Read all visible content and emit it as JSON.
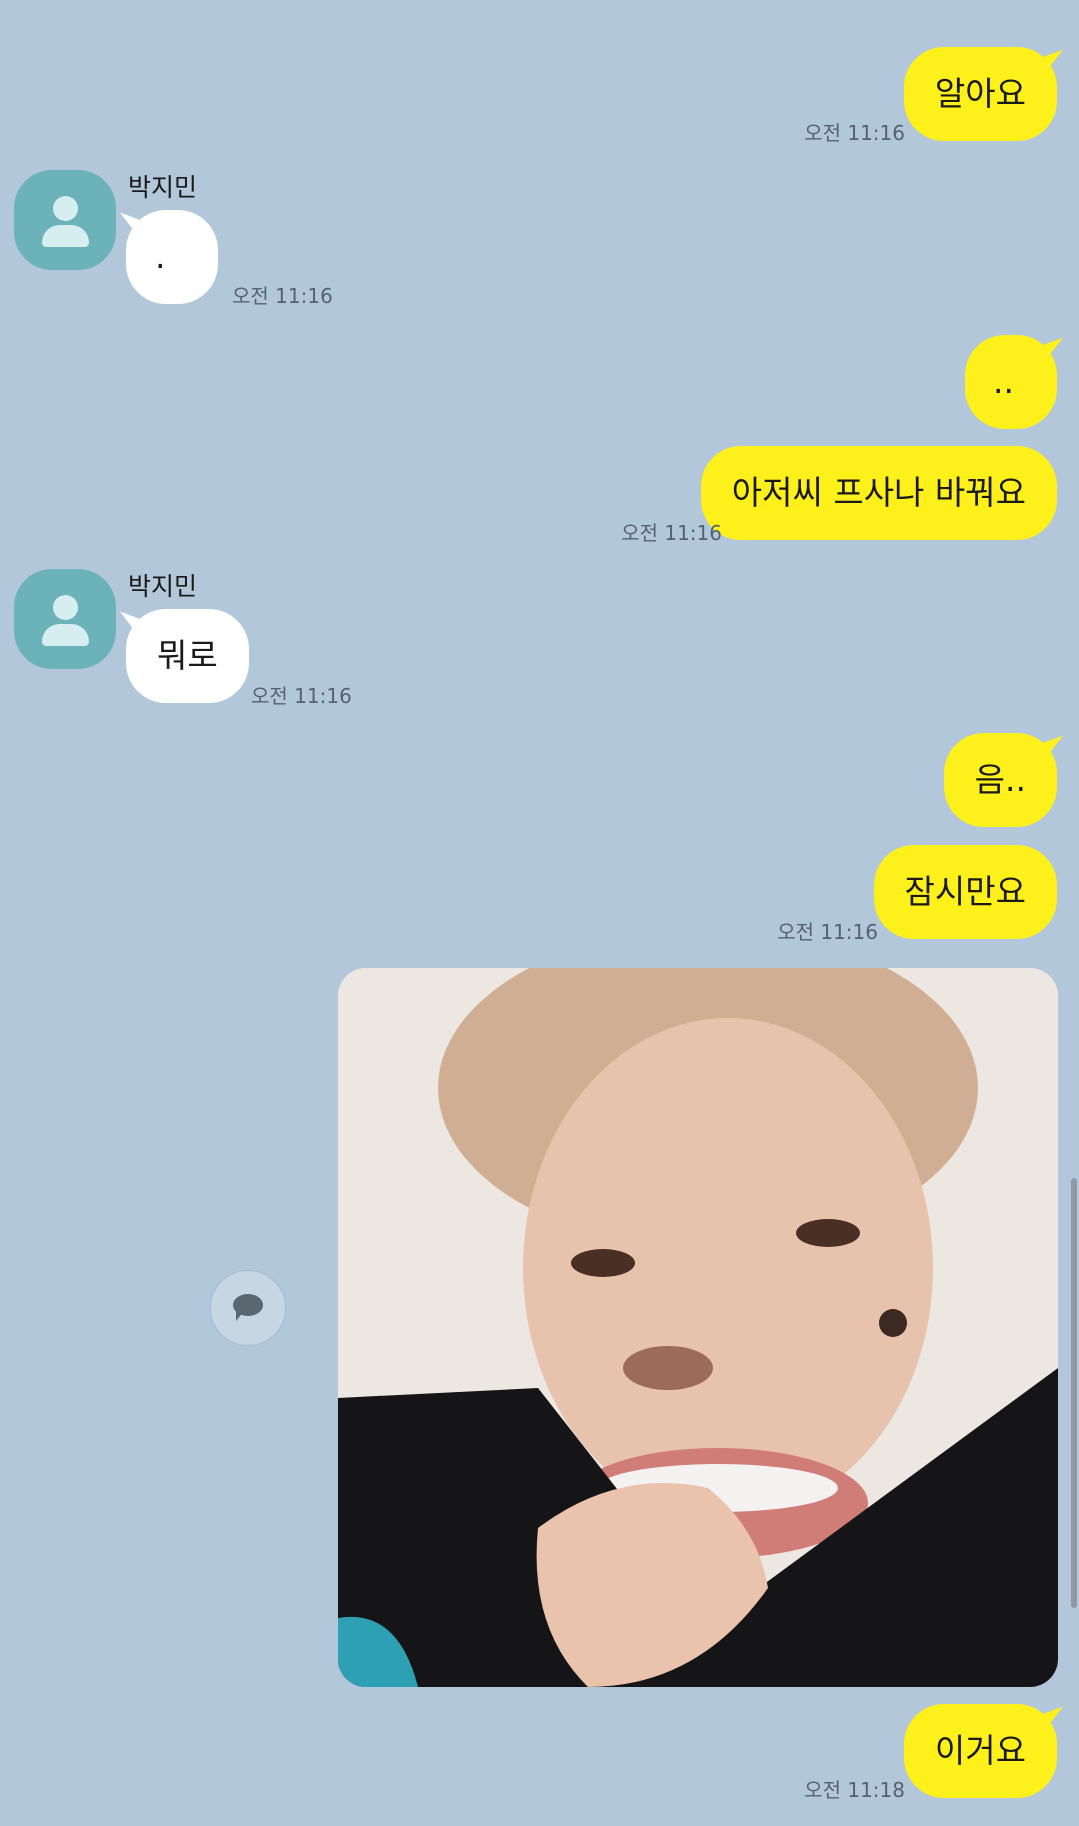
{
  "colors": {
    "background": "#b2c7da",
    "my_bubble": "#fef01b",
    "their_bubble": "#ffffff",
    "avatar": "#6cb2b9"
  },
  "messages": [
    {
      "from": "me",
      "text": "알아요",
      "time": "오전 11:16"
    },
    {
      "from": "them",
      "sender": "박지민",
      "text": ".",
      "time": "오전 11:16"
    },
    {
      "from": "me",
      "text": ".."
    },
    {
      "from": "me",
      "text": "아저씨 프사나 바꿔요",
      "time": "오전 11:16"
    },
    {
      "from": "them",
      "sender": "박지민",
      "text": "뭐로",
      "time": "오전 11:16"
    },
    {
      "from": "me",
      "text": "음.."
    },
    {
      "from": "me",
      "text": "잠시만요",
      "time": "오전 11:16"
    },
    {
      "from": "me",
      "type": "image"
    },
    {
      "from": "me",
      "text": "이거요",
      "time": "오전 11:18"
    }
  ],
  "icons": {
    "avatar": "person-icon",
    "comment": "speech-bubble-icon"
  }
}
